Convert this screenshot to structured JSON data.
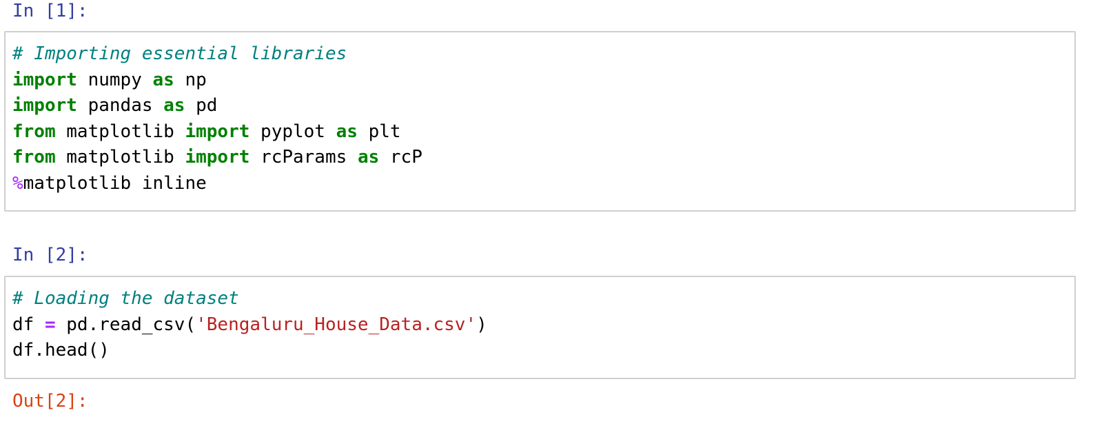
{
  "cells": [
    {
      "prompt": "In [1]:",
      "lines": [
        [
          {
            "t": "# Importing essential libraries",
            "c": "comment"
          }
        ],
        [
          {
            "t": "import",
            "c": "kw"
          },
          {
            "t": " numpy ",
            "c": ""
          },
          {
            "t": "as",
            "c": "kw"
          },
          {
            "t": " np",
            "c": ""
          }
        ],
        [
          {
            "t": "import",
            "c": "kw"
          },
          {
            "t": " pandas ",
            "c": ""
          },
          {
            "t": "as",
            "c": "kw"
          },
          {
            "t": " pd",
            "c": ""
          }
        ],
        [
          {
            "t": "from",
            "c": "kw"
          },
          {
            "t": " matplotlib ",
            "c": ""
          },
          {
            "t": "import",
            "c": "kw"
          },
          {
            "t": " pyplot ",
            "c": ""
          },
          {
            "t": "as",
            "c": "kw"
          },
          {
            "t": " plt",
            "c": ""
          }
        ],
        [
          {
            "t": "from",
            "c": "kw"
          },
          {
            "t": " matplotlib ",
            "c": ""
          },
          {
            "t": "import",
            "c": "kw"
          },
          {
            "t": " rcParams ",
            "c": ""
          },
          {
            "t": "as",
            "c": "kw"
          },
          {
            "t": " rcP",
            "c": ""
          }
        ],
        [
          {
            "t": "%",
            "c": "magic"
          },
          {
            "t": "matplotlib inline",
            "c": ""
          }
        ]
      ]
    },
    {
      "prompt": "In [2]:",
      "lines": [
        [
          {
            "t": "# Loading the dataset",
            "c": "comment"
          }
        ],
        [
          {
            "t": "df ",
            "c": ""
          },
          {
            "t": "=",
            "c": "op"
          },
          {
            "t": " pd.read_csv(",
            "c": ""
          },
          {
            "t": "'Bengaluru_House_Data.csv'",
            "c": "str"
          },
          {
            "t": ")",
            "c": ""
          }
        ],
        [
          {
            "t": "df.head()",
            "c": ""
          }
        ]
      ]
    }
  ],
  "output_prompt": "Out[2]:"
}
